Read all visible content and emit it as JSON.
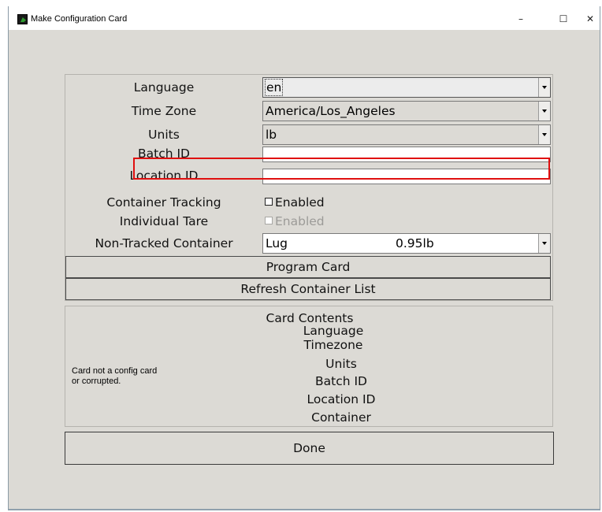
{
  "window": {
    "title": "Make Configuration Card",
    "minimize": "–",
    "maximize": "☐",
    "close": "✕"
  },
  "form": {
    "language": {
      "label": "Language",
      "value": "en"
    },
    "time_zone": {
      "label": "Time Zone",
      "value": "America/Los_Angeles"
    },
    "units": {
      "label": "Units",
      "value": "lb"
    },
    "batch_id": {
      "label": "Batch ID",
      "value": ""
    },
    "location_id": {
      "label": "Location ID",
      "value": ""
    },
    "container_tracking": {
      "label": "Container Tracking",
      "checkbox_label": "Enabled",
      "checked": false
    },
    "individual_tare": {
      "label": "Individual Tare",
      "checkbox_label": "Enabled",
      "checked": false,
      "disabled": true
    },
    "non_tracked_container": {
      "label": "Non-Tracked Container",
      "name": "Lug",
      "weight": "0.95lb"
    }
  },
  "buttons": {
    "program_card": "Program Card",
    "refresh_container_list": "Refresh Container List",
    "done": "Done"
  },
  "card_contents": {
    "title": "Card Contents",
    "fields": [
      "Language",
      "Timezone",
      "Units",
      "Batch ID",
      "Location ID",
      "Container"
    ],
    "status_line1": "Card not a config card",
    "status_line2": "or corrupted."
  },
  "colors": {
    "background": "#dcdad5",
    "highlight": "#e01010"
  },
  "icons": {
    "app": "app-icon",
    "dropdown": "chevron-down-icon",
    "checkbox": "checkbox-icon"
  }
}
